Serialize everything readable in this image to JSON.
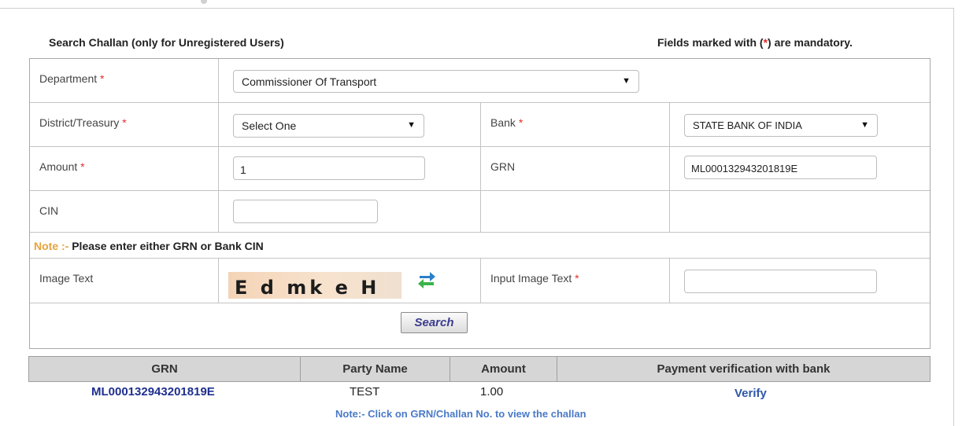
{
  "header": {
    "title": "Search Challan (only for Unregistered Users)",
    "mandatory_prefix": "Fields marked with (",
    "mandatory_star": "*",
    "mandatory_suffix": ") are mandatory."
  },
  "form": {
    "department": {
      "label": "Department",
      "required": "*",
      "value": "Commissioner Of Transport"
    },
    "district": {
      "label": "District/Treasury",
      "required": "*",
      "value": "Select One"
    },
    "bank": {
      "label": "Bank",
      "required": "*",
      "value": "STATE BANK OF INDIA"
    },
    "amount": {
      "label": "Amount",
      "required": "*",
      "value": "1"
    },
    "grn": {
      "label": "GRN",
      "value": "ML000132943201819E"
    },
    "cin": {
      "label": "CIN",
      "value": ""
    },
    "note": {
      "key": "Note :-",
      "text": " Please enter either GRN or Bank CIN"
    },
    "image_text": {
      "label": "Image Text",
      "captcha": "E d mk e H"
    },
    "input_image_text": {
      "label": "Input Image Text",
      "required": "*",
      "value": ""
    },
    "search_label": "Search"
  },
  "results": {
    "columns": [
      "GRN",
      "Party Name",
      "Amount",
      "Payment verification with bank"
    ],
    "rows": [
      {
        "grn": "ML000132943201819E",
        "party_name": "TEST",
        "amount": "1.00",
        "action": "Verify"
      }
    ],
    "note": "Note:- Click on GRN/Challan No. to view the challan"
  },
  "icons": {
    "dropdown": "chevron-down-icon",
    "refresh": "refresh-icon"
  },
  "colors": {
    "required_star": "#e0322b",
    "note_key": "#e8a33a",
    "header_bg": "#d6d6d6",
    "grn_link": "#1e2f8f",
    "verify_link": "#2e56a8",
    "foot_note": "#4a7ac7"
  }
}
